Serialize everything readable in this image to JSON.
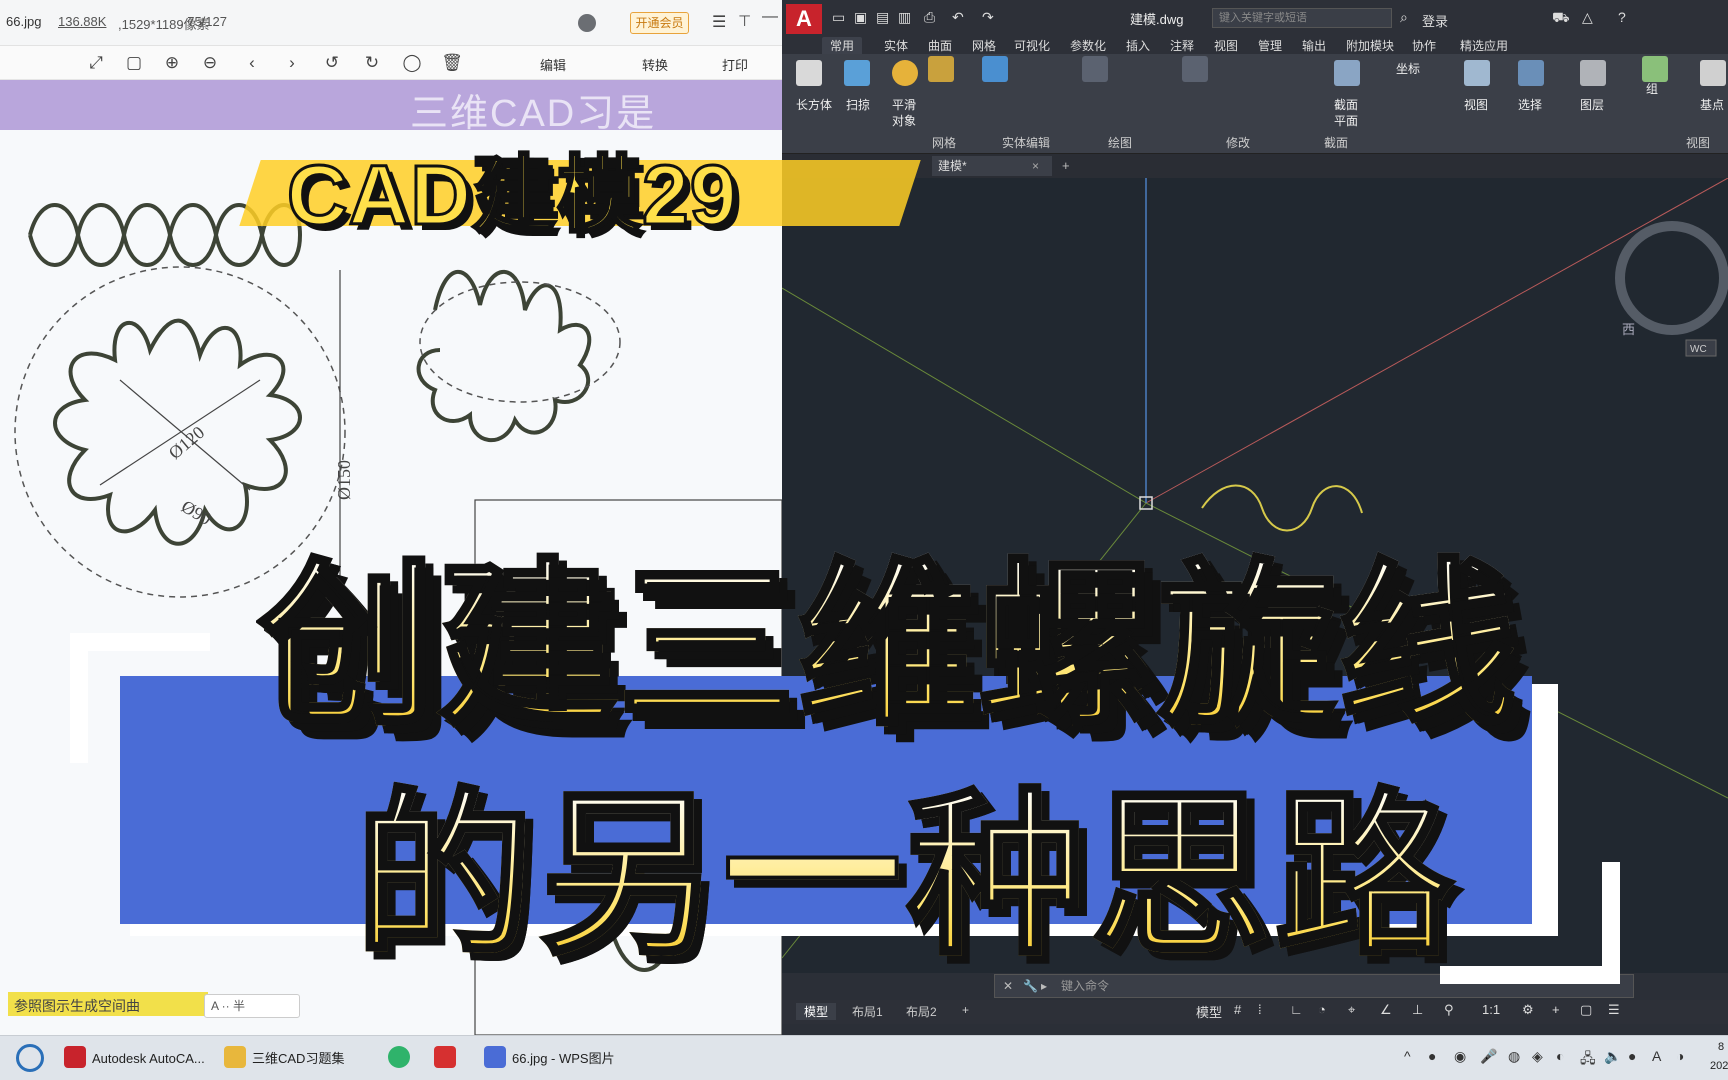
{
  "viewer": {
    "filename": "66.jpg",
    "filesize": "136.88K",
    "dimensions": ",1529*1189像素",
    "page": ", 75/127",
    "vip_label": "开通会员",
    "tools": {
      "edit_label": "编辑",
      "convert_label": "转换",
      "print_label": "打印"
    },
    "paper_heading": "三维CAD习是",
    "paper_ref_text": "参照图示生成空间曲",
    "ime_text": "A ·· 半",
    "dim_120": "Ø120",
    "dim_90": "Ø90",
    "dim_150": "Ø150"
  },
  "acad": {
    "logo": "A",
    "doc_title": "建模.dwg",
    "search_placeholder": "键入关键字或短语",
    "login_label": "登录",
    "ribbon_tabs": [
      "常用",
      "实体",
      "曲面",
      "网格",
      "可视化",
      "参数化",
      "插入",
      "注释",
      "视图",
      "管理",
      "输出",
      "附加模块",
      "协作",
      "精选应用"
    ],
    "ribbon_big": {
      "box": "长方体",
      "sweep": "扫掠",
      "smooth_1": "平滑",
      "smooth_2": "对象",
      "section_1": "截面",
      "section_2": "平面",
      "coord": "坐标",
      "view": "视图",
      "select": "选择",
      "layer": "图层",
      "group": "组",
      "base": "基点"
    },
    "ribbon_groups": [
      "网格",
      "实体编辑",
      "绘图",
      "修改",
      "截面",
      "视图"
    ],
    "file_tab": "建模*",
    "cmd_placeholder": "键入命令",
    "layout_tabs": [
      "模型",
      "布局1",
      "布局2"
    ],
    "status_model": "模型",
    "status_scale": "1:1",
    "viewcube_west": "西",
    "viewcube_wcs": "WC"
  },
  "taskbar": {
    "apps": [
      "Autodesk AutoCA...",
      "三维CAD习题集",
      "66.jpg - WPS图片"
    ],
    "clock_line1": "8",
    "clock_line2": "202"
  },
  "overlay": {
    "tag": "CAD建模29",
    "title_line1": "创建三维螺旋线",
    "title_line2": "的另一种思路"
  }
}
